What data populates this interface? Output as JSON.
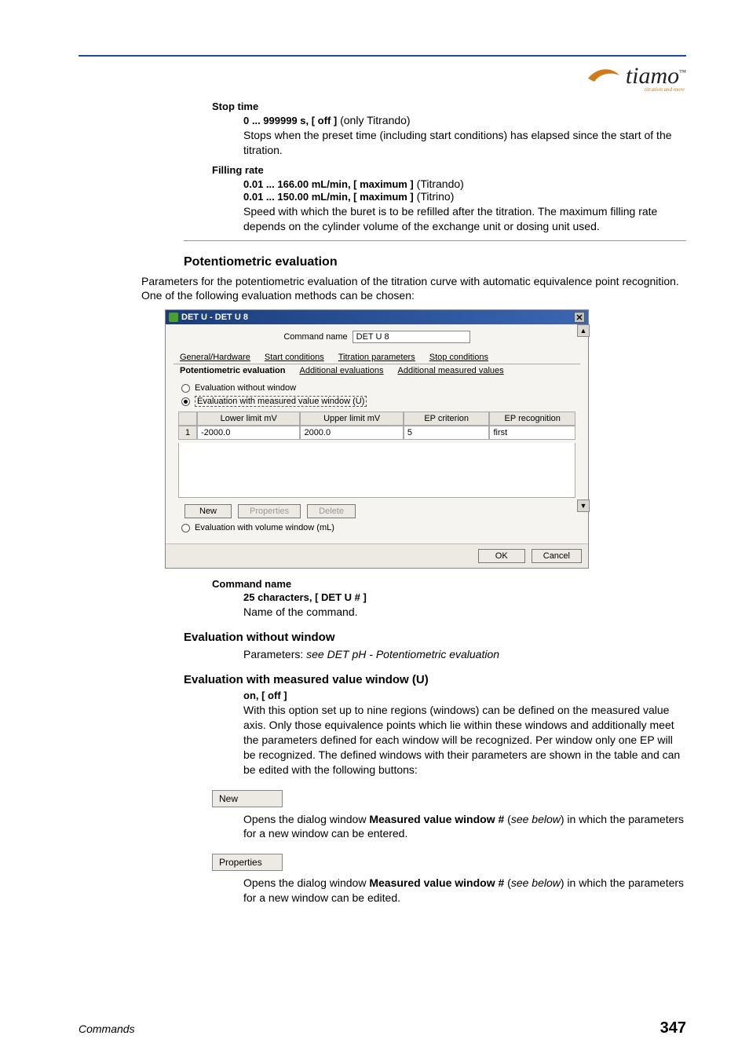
{
  "logo": {
    "text": "tiamo",
    "tm": "™",
    "sub": "titration and more"
  },
  "stop_time": {
    "label": "Stop time",
    "spec": "0 ... 999999 s, [ off ]",
    "spec_note": " (only Titrando)",
    "desc": "Stops when the preset time (including start conditions) has elapsed since the start of the titration."
  },
  "filling_rate": {
    "label": "Filling rate",
    "spec1": "0.01 ... 166.00 mL/min, [ maximum ]",
    "spec1_note": " (Titrando)",
    "spec2": "0.01 ... 150.00 mL/min, [ maximum ]",
    "spec2_note": " (Titrino)",
    "desc": "Speed with which the buret is to be refilled after the titration. The maximum filling rate depends on the cylinder volume of the exchange unit or dosing unit used."
  },
  "sect_potent": {
    "title": "Potentiometric evaluation",
    "intro": "Parameters for the potentiometric evaluation of the titration curve with automatic equivalence point recognition. One of the following evaluation methods can be chosen:"
  },
  "dialog": {
    "title": "DET U - DET U 8",
    "cmd_label": "Command name",
    "cmd_value": "DET U 8",
    "tabs1": {
      "a": "General/Hardware",
      "b": "Start conditions",
      "c": "Titration parameters",
      "d": "Stop conditions"
    },
    "tabs2": {
      "a": "Potentiometric evaluation",
      "b": "Additional evaluations",
      "c": "Additional measured values"
    },
    "radio_no_window": "Evaluation without window",
    "radio_mv_window": "Evaluation with measured value window (U)",
    "cols": {
      "lower": "Lower limit mV",
      "upper": "Upper limit mV",
      "crit": "EP criterion",
      "rec": "EP recognition"
    },
    "row": {
      "idx": "1",
      "lower": "-2000.0",
      "upper": "2000.0",
      "crit": "5",
      "rec": "first"
    },
    "btn_new": "New",
    "btn_prop": "Properties",
    "btn_del": "Delete",
    "radio_vol_window": "Evaluation with volume window (mL)",
    "ok": "OK",
    "cancel": "Cancel"
  },
  "cmdname": {
    "label": "Command name",
    "spec": "25 characters, [ DET U # ]",
    "desc": "Name of the command."
  },
  "eval_no_window": {
    "title": "Evaluation without window",
    "desc_pre": "Parameters: ",
    "desc_ital": "see DET pH - Potentiometric evaluation"
  },
  "eval_mv_window": {
    "title": "Evaluation with measured value window (U)",
    "spec": "on, [ off ]",
    "desc": "With this option set up to nine regions (windows) can be defined on the measured value axis. Only those equivalence points which lie within these windows and additionally meet the parameters defined for each window will be recognized. Per window only one EP will be recognized. The defined windows with their parameters are shown in the table and can be edited with the following buttons:"
  },
  "btn_new_img": "New",
  "new_desc_pre": "Opens the dialog window ",
  "new_desc_bold": "Measured value window #",
  "new_desc_mid": " (",
  "new_desc_ital": "see below",
  "new_desc_post": ") in which the parameters for a new window can be entered.",
  "btn_prop_img": "Properties",
  "prop_desc_pre": "Opens the dialog window ",
  "prop_desc_bold": "Measured value window #",
  "prop_desc_mid": " (",
  "prop_desc_ital": "see below",
  "prop_desc_post": ") in which the parameters for a new window can be edited.",
  "footer": {
    "section": "Commands",
    "page": "347"
  }
}
